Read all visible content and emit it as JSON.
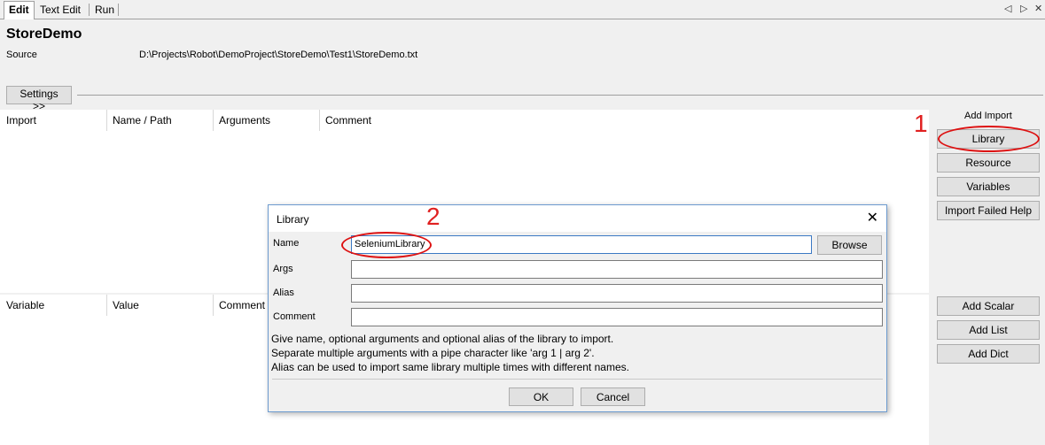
{
  "tabs": [
    {
      "label": "Edit",
      "active": true
    },
    {
      "label": "Text Edit",
      "active": false
    },
    {
      "label": "Run",
      "active": false
    }
  ],
  "nav": {
    "prev_icon": "triangle-left-icon",
    "next_icon": "triangle-right-icon",
    "prev_glyph": "◁",
    "next_glyph": "▷",
    "close_glyph": "✕"
  },
  "suite": {
    "name": "StoreDemo",
    "source_label": "Source",
    "source_path": "D:\\Projects\\Robot\\DemoProject\\StoreDemo\\Test1\\StoreDemo.txt"
  },
  "settings_button": "Settings >>",
  "import_table": {
    "headers": [
      "Import",
      "Name / Path",
      "Arguments",
      "Comment"
    ]
  },
  "variable_table": {
    "headers": [
      "Variable",
      "Value",
      "Comment"
    ]
  },
  "add_import": {
    "label": "Add Import",
    "buttons": [
      "Library",
      "Resource",
      "Variables",
      "Import Failed Help"
    ]
  },
  "add_variable": {
    "buttons": [
      "Add Scalar",
      "Add List",
      "Add Dict"
    ]
  },
  "dialog": {
    "title": "Library",
    "close_glyph": "✕",
    "fields": {
      "name": {
        "label": "Name",
        "value": "SeleniumLibrary"
      },
      "args": {
        "label": "Args",
        "value": ""
      },
      "alias": {
        "label": "Alias",
        "value": ""
      },
      "comment": {
        "label": "Comment",
        "value": ""
      }
    },
    "browse_button": "Browse",
    "help_lines": [
      "Give name, optional arguments and optional alias of the library to import.",
      "Separate multiple arguments with a pipe character like 'arg 1 | arg 2'.",
      "Alias can be used to import same library multiple times with different names."
    ],
    "ok_button": "OK",
    "cancel_button": "Cancel"
  },
  "annotations": {
    "marker_1": "1",
    "marker_2": "2",
    "color": "#e02020"
  }
}
